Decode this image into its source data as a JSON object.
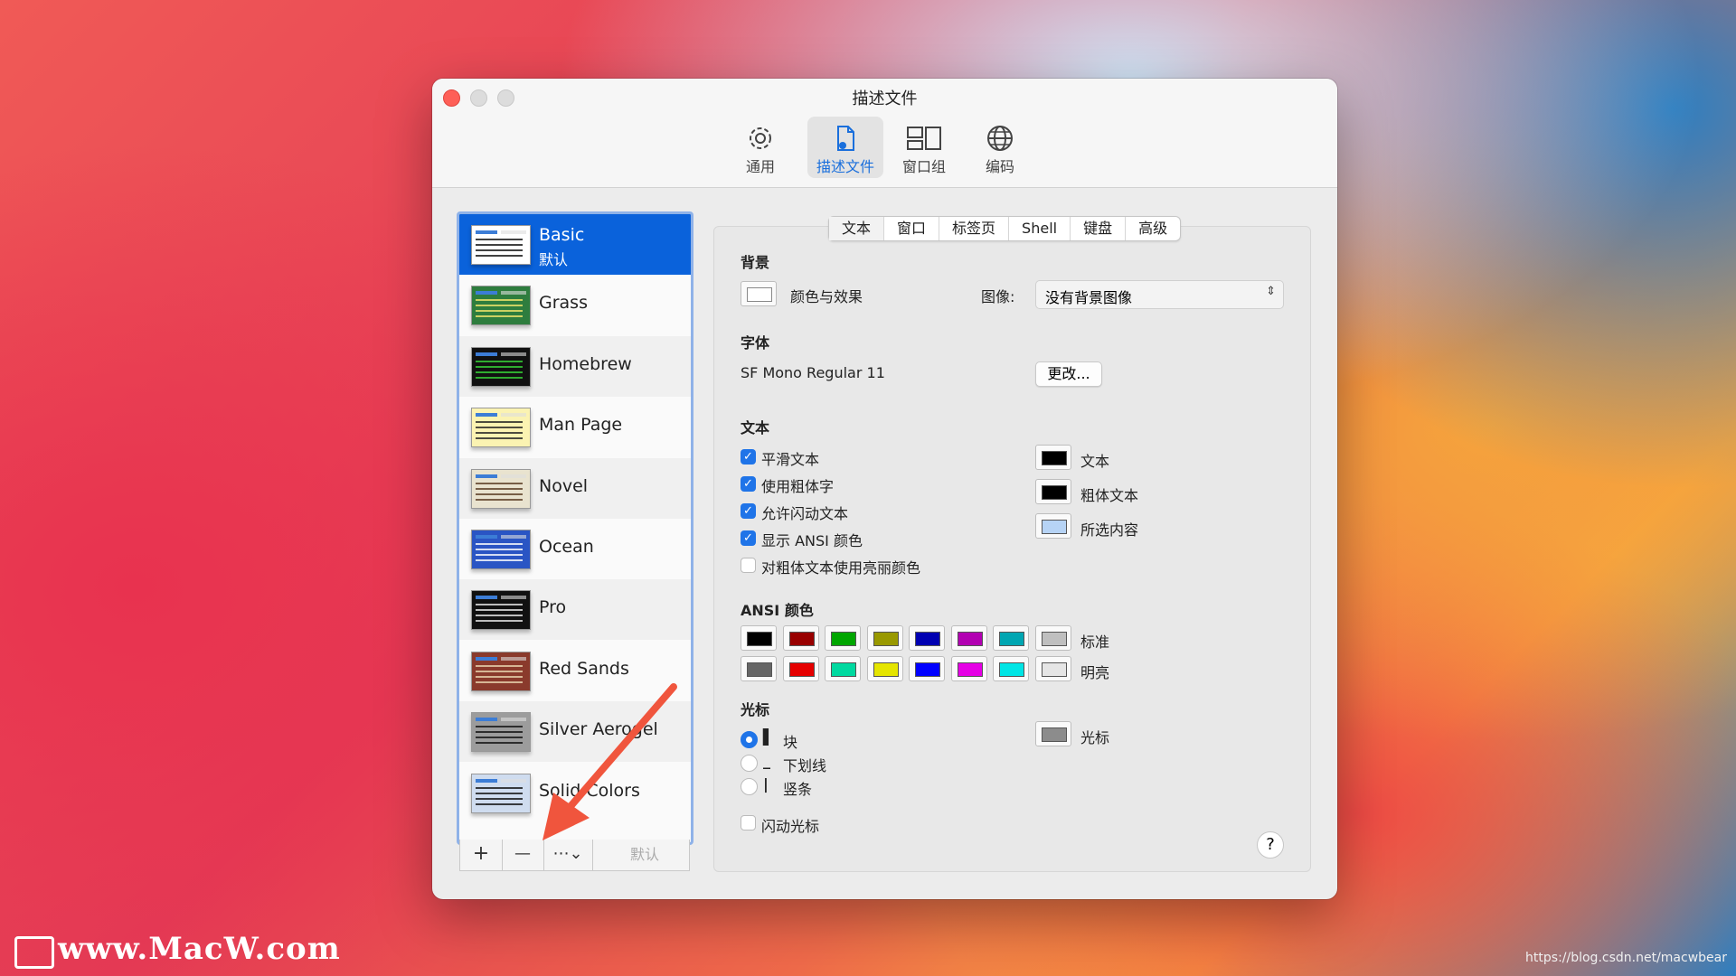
{
  "window": {
    "title": "描述文件"
  },
  "toolbar": {
    "items": [
      {
        "label": "通用",
        "icon": "gear-icon"
      },
      {
        "label": "描述文件",
        "icon": "profile-document-icon",
        "active": true
      },
      {
        "label": "窗口组",
        "icon": "window-group-icon"
      },
      {
        "label": "编码",
        "icon": "globe-icon"
      }
    ]
  },
  "profiles": [
    {
      "name": "Basic",
      "sub": "默认",
      "selected": true,
      "bg": "#ffffff",
      "fg": "#111111"
    },
    {
      "name": "Grass",
      "bg": "#2e7d3e",
      "fg": "#f2e66b"
    },
    {
      "name": "Homebrew",
      "bg": "#111111",
      "fg": "#37d337"
    },
    {
      "name": "Man Page",
      "bg": "#fbf3b2",
      "fg": "#222222"
    },
    {
      "name": "Novel",
      "bg": "#e9e3cf",
      "fg": "#5a3c23"
    },
    {
      "name": "Ocean",
      "bg": "#2a55c4",
      "fg": "#ffffff"
    },
    {
      "name": "Pro",
      "bg": "#111111",
      "fg": "#e9e9e9"
    },
    {
      "name": "Red Sands",
      "bg": "#8a3a2c",
      "fg": "#e8d6b0"
    },
    {
      "name": "Silver Aerogel",
      "bg": "#9c9c9c",
      "fg": "#111111"
    },
    {
      "name": "Solid Colors",
      "bg": "#cfdcef",
      "fg": "#111111"
    }
  ],
  "sidebar_footer": {
    "add": "+",
    "remove": "—",
    "actions": "⋯⌄",
    "default": "默认"
  },
  "tabs": [
    "文本",
    "窗口",
    "标签页",
    "Shell",
    "键盘",
    "高级"
  ],
  "settings": {
    "background": {
      "heading": "背景",
      "color_effects": "颜色与效果",
      "image_label": "图像:",
      "image_value": "没有背景图像"
    },
    "font": {
      "heading": "字体",
      "value": "SF Mono Regular 11",
      "change": "更改..."
    },
    "text": {
      "heading": "文本",
      "options": [
        {
          "label": "平滑文本",
          "checked": true
        },
        {
          "label": "使用粗体字",
          "checked": true
        },
        {
          "label": "允许闪动文本",
          "checked": true
        },
        {
          "label": "显示 ANSI 颜色",
          "checked": true
        },
        {
          "label": "对粗体文本使用亮丽颜色",
          "checked": false
        }
      ],
      "colors": [
        {
          "label": "文本",
          "color": "#000000"
        },
        {
          "label": "粗体文本",
          "color": "#000000"
        },
        {
          "label": "所选内容",
          "color": "#b6d3f5"
        }
      ]
    },
    "ansi": {
      "heading": "ANSI 颜色",
      "normal_label": "标准",
      "bright_label": "明亮",
      "normal": [
        "#000000",
        "#990000",
        "#00a600",
        "#999900",
        "#0000b2",
        "#b200b2",
        "#00a6b2",
        "#bfbfbf"
      ],
      "bright": [
        "#666666",
        "#e50000",
        "#00d9a0",
        "#e5e500",
        "#0000ff",
        "#e500e5",
        "#00e5e5",
        "#e5e5e5"
      ]
    },
    "cursor": {
      "heading": "光标",
      "options": [
        {
          "label": "块",
          "glyph": "▌",
          "selected": true
        },
        {
          "label": "下划线",
          "glyph": "_",
          "selected": false
        },
        {
          "label": "竖条",
          "glyph": "|",
          "selected": false
        }
      ],
      "blink": "闪动光标",
      "color_label": "光标",
      "color": "#8c8c8c"
    },
    "help": "?"
  },
  "watermark": {
    "text": "www.MacW.com",
    "credit": "https://blog.csdn.net/macwbear"
  }
}
